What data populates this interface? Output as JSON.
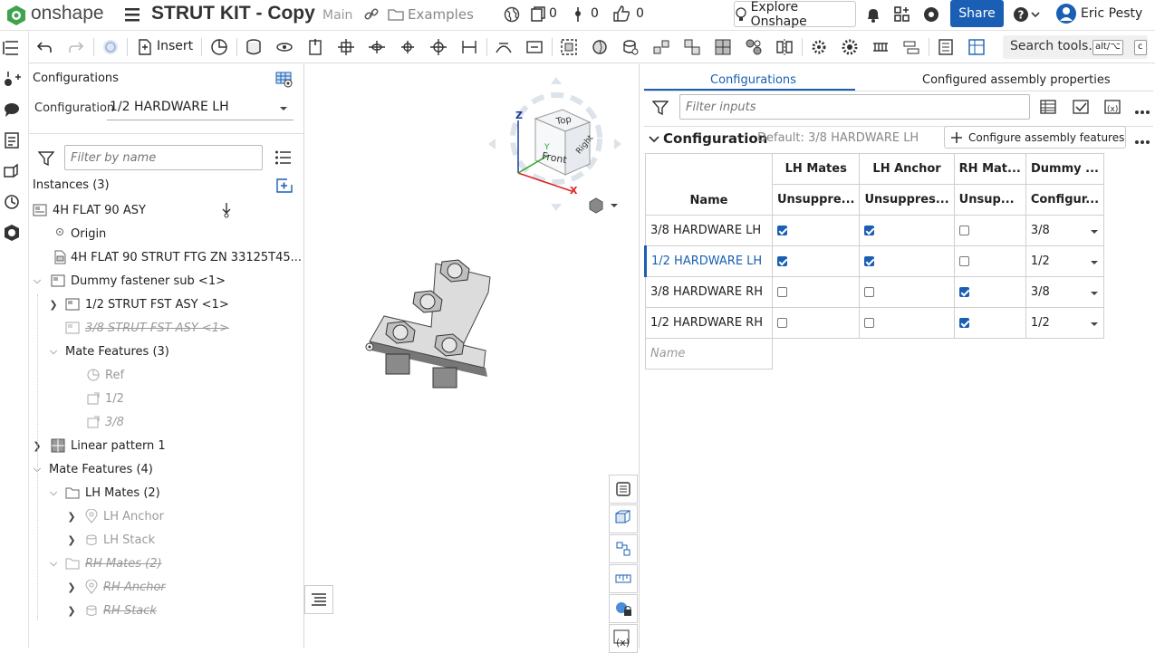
{
  "app": {
    "brand": "onshape",
    "doc_title": "STRUT KIT - Copy",
    "branch": "Main",
    "folder": "Examples",
    "versions": "0",
    "branches": "0",
    "likes": "0",
    "explore": "Explore Onshape",
    "share": "Share",
    "user": "Eric Pesty"
  },
  "toolbar": {
    "insert": "Insert",
    "search": "Search tools...",
    "kbd1": "alt/⌥",
    "kbd2": "c"
  },
  "config_panel": {
    "title": "Configurations",
    "config_label": "Configuration",
    "config_value": "1/2 HARDWARE LH"
  },
  "filter": {
    "placeholder": "Filter by name"
  },
  "instances": {
    "title": "Instances (3)"
  },
  "tree": [
    {
      "label": "4H FLAT 90 ASY",
      "state": "normal"
    },
    {
      "label": "Origin",
      "state": "normal"
    },
    {
      "label": "4H FLAT 90 STRUT FTG ZN 33125T45...",
      "state": "normal"
    },
    {
      "label": "Dummy fastener sub <1>",
      "state": "normal"
    },
    {
      "label": "1/2 STRUT FST ASY <1>",
      "state": "normal"
    },
    {
      "label": "3/8 STRUT FST ASY <1>",
      "state": "suppressed"
    },
    {
      "label": "Mate Features (3)",
      "state": "normal"
    },
    {
      "label": "Ref",
      "state": "dim"
    },
    {
      "label": "1/2",
      "state": "dim"
    },
    {
      "label": "3/8",
      "state": "dim"
    },
    {
      "label": "Linear pattern 1",
      "state": "normal"
    },
    {
      "label": "Mate Features (4)",
      "state": "normal"
    },
    {
      "label": "LH Mates (2)",
      "state": "normal"
    },
    {
      "label": "LH Anchor",
      "state": "dim"
    },
    {
      "label": "LH Stack",
      "state": "dim"
    },
    {
      "label": "RH Mates (2)",
      "state": "suppressed"
    },
    {
      "label": "RH Anchor",
      "state": "suppressed"
    },
    {
      "label": "RH Stack",
      "state": "suppressed"
    }
  ],
  "viewcube": {
    "top": "Top",
    "front": "Front",
    "right": "Right",
    "x": "X",
    "y": "Y",
    "z": "Z"
  },
  "right_panel": {
    "tab_configurations": "Configurations",
    "tab_properties": "Configured assembly properties",
    "filter_placeholder": "Filter inputs",
    "section_title": "Configuration",
    "default_text": "Default: 3/8 HARDWARE LH",
    "configure_btn": "Configure assembly features",
    "name_placeholder": "Name"
  },
  "table": {
    "headers": [
      "LH Mates",
      "LH Anchor",
      "RH Mat...",
      "Dummy ..."
    ],
    "subheaders": [
      "Unsuppre...",
      "Unsuppres...",
      "Unsup...",
      "Configur..."
    ],
    "name_header": "Name",
    "rows": [
      {
        "name": "3/8 HARDWARE LH",
        "lh_mates": true,
        "lh_anchor": true,
        "rh_mates": false,
        "dummy": "3/8",
        "selected": false
      },
      {
        "name": "1/2 HARDWARE LH",
        "lh_mates": true,
        "lh_anchor": true,
        "rh_mates": false,
        "dummy": "1/2",
        "selected": true
      },
      {
        "name": "3/8 HARDWARE RH",
        "lh_mates": false,
        "lh_anchor": false,
        "rh_mates": true,
        "dummy": "3/8",
        "selected": false
      },
      {
        "name": "1/2 HARDWARE RH",
        "lh_mates": false,
        "lh_anchor": false,
        "rh_mates": true,
        "dummy": "1/2",
        "selected": false
      }
    ]
  },
  "colors": {
    "accent": "#1a5fb4",
    "logo_green": "#3fa34d",
    "share_btn": "#1a5fb4"
  }
}
